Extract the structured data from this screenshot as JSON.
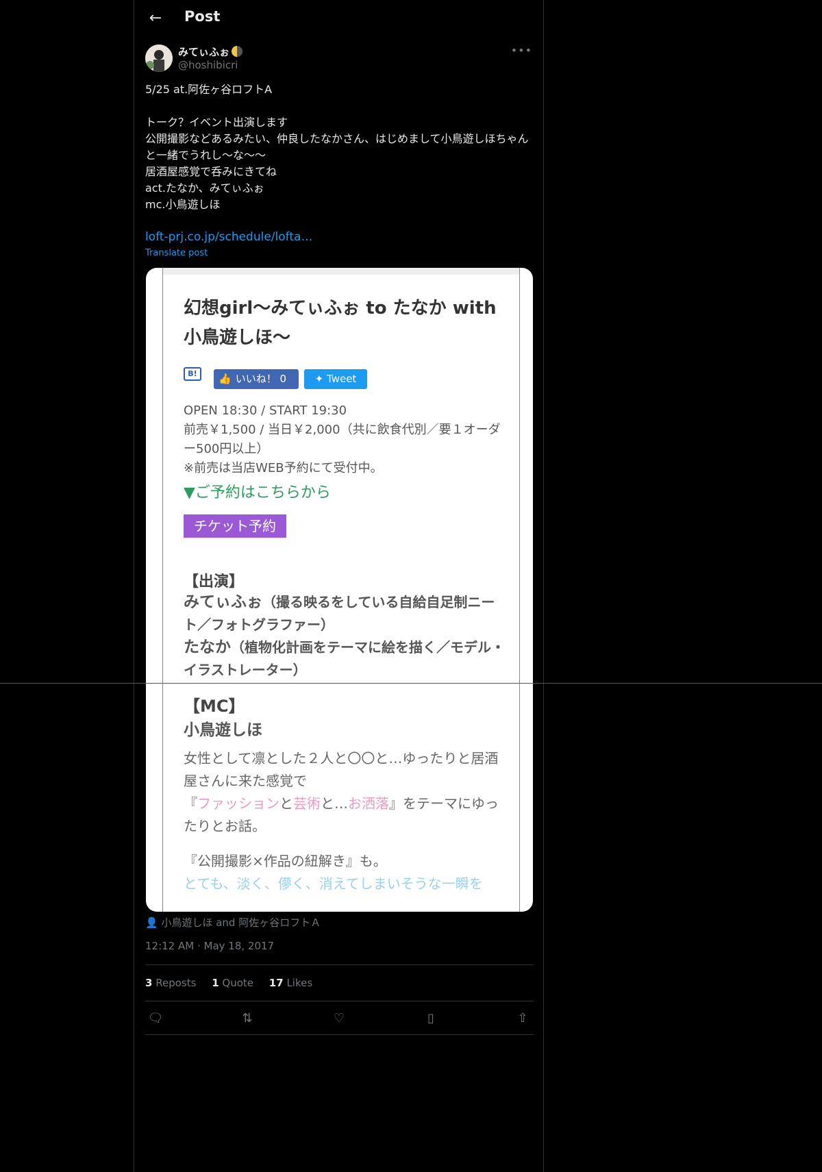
{
  "header": {
    "title": "Post"
  },
  "author": {
    "name": "みてぃふぉ",
    "handle": "@hoshibicri"
  },
  "post": {
    "text": "5/25 at.阿佐ヶ谷ロフトA\n\nトーク？イベント出演します\n公開撮影などあるみたい、仲良したなかさん、はじめまして小鳥遊しほちゃんと一緒でうれし〜な〜〜\n居酒屋感覚で呑みにきてね\nact.たなか、みてぃふぉ\nmc.小鳥遊しほ",
    "link": "loft-prj.co.jp/schedule/lofta…",
    "translate": "Translate post"
  },
  "media": {
    "title": "幻想girl〜みてぃふぉ to たなか with 小鳥遊しほ〜",
    "hatena": "B!",
    "like_label": "いいね！ 0",
    "tweet_label": "Tweet",
    "open_start": "OPEN 18:30 / START 19:30",
    "price": "前売￥1,500 / 当日￥2,000（共に飲食代別／要１オーダー500円以上）",
    "web_note": "※前売は当店WEB予約にて受付中。",
    "reserve": "▼ご予約はこちらから",
    "ticket": "チケット予約",
    "cast_heading": "【出演】",
    "cast_1_name": "みてぃふぉ",
    "cast_1_desc": "（撮る映るをしている自給自足制ニート／フォトグラファー）",
    "cast_2_name": "たなか",
    "cast_2_desc": "（植物化計画をテーマに絵を描く／モデル・イラストレーター）",
    "mc_heading": "【MC】",
    "mc_name": "小鳥遊しほ",
    "desc_1": "女性として凛とした２人と〇〇と…ゆったりと居酒屋さんに来た感覚で",
    "desc_q_open": "『",
    "desc_fashion": "ファッション",
    "desc_to1": "と",
    "desc_art": "芸術",
    "desc_to2": "と…",
    "desc_oshare": "お洒落",
    "desc_q_close": "』をテーマにゆったりとお話。",
    "desc_2": "『公開撮影×作品の紐解き』も。",
    "desc_3": "とても、淡く、儚く、消えてしまいそうな一瞬を"
  },
  "tagged": "小鳥遊しほ and 阿佐ヶ谷ロフトＡ",
  "timestamp": "12:12 AM · May 18, 2017",
  "stats": {
    "reposts_count": "3",
    "reposts_label": "Reposts",
    "quote_count": "1",
    "quote_label": "Quote",
    "likes_count": "17",
    "likes_label": "Likes"
  }
}
